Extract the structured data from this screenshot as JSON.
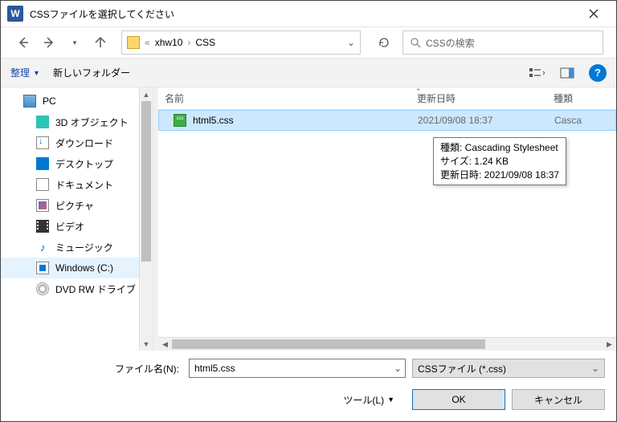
{
  "window": {
    "title": "CSSファイルを選択してください"
  },
  "path": {
    "seg1": "xhw10",
    "seg2": "CSS"
  },
  "search": {
    "placeholder": "CSSの検索"
  },
  "toolbar": {
    "organize": "整理",
    "new_folder": "新しいフォルダー"
  },
  "tree": {
    "items": [
      {
        "label": "PC"
      },
      {
        "label": "3D オブジェクト"
      },
      {
        "label": "ダウンロード"
      },
      {
        "label": "デスクトップ"
      },
      {
        "label": "ドキュメント"
      },
      {
        "label": "ピクチャ"
      },
      {
        "label": "ビデオ"
      },
      {
        "label": "ミュージック"
      },
      {
        "label": "Windows (C:)"
      },
      {
        "label": "DVD RW ドライブ"
      }
    ]
  },
  "columns": {
    "name": "名前",
    "date": "更新日時",
    "type": "種類"
  },
  "files": [
    {
      "name": "html5.css",
      "date": "2021/09/08 18:37",
      "type": "Casca"
    }
  ],
  "tooltip": {
    "line1": "種類: Cascading Stylesheet",
    "line2": "サイズ: 1.24 KB",
    "line3": "更新日時: 2021/09/08 18:37"
  },
  "footer": {
    "filename_label": "ファイル名(N):",
    "filename_value": "html5.css",
    "filter": "CSSファイル (*.css)",
    "tools": "ツール(L)",
    "ok": "OK",
    "cancel": "キャンセル"
  }
}
